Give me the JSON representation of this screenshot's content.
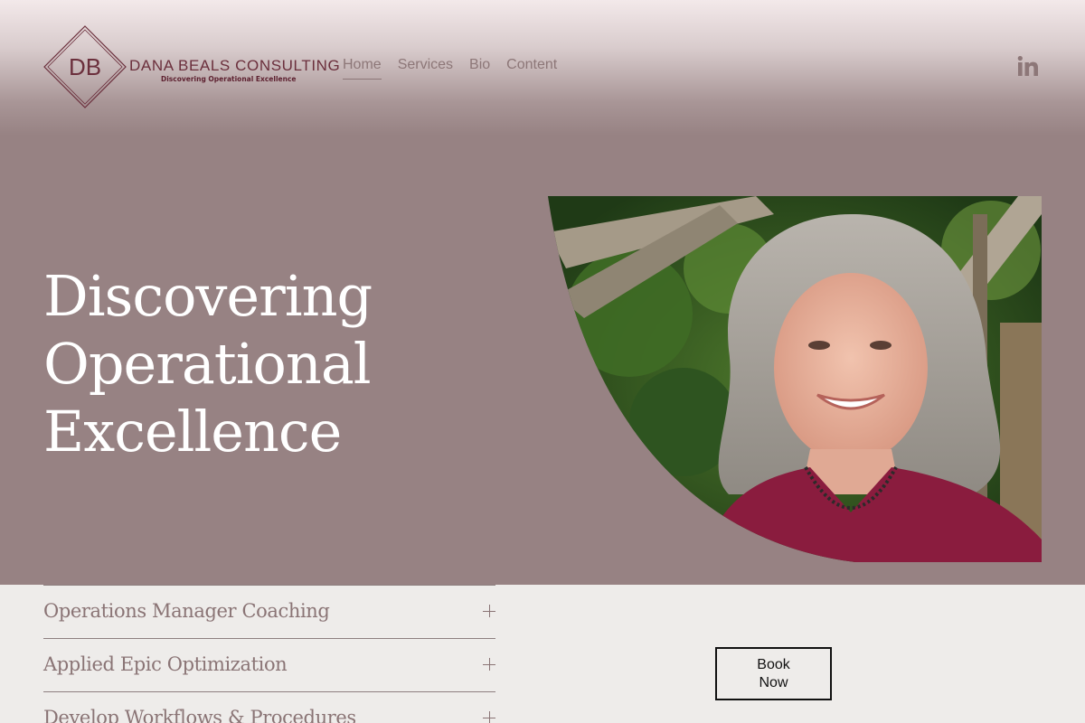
{
  "brand": {
    "monogram": "DB",
    "name": "Dana Beals Consulting",
    "tagline": "Discovering Operational Excellence",
    "accent_color": "#6b2f3c"
  },
  "nav": {
    "items": [
      {
        "label": "Home",
        "active": true
      },
      {
        "label": "Services",
        "active": false
      },
      {
        "label": "Bio",
        "active": false
      },
      {
        "label": "Content",
        "active": false
      }
    ],
    "social_icon": "linkedin-icon"
  },
  "hero": {
    "title": "Discovering Operational Excellence",
    "background_color": "#978283"
  },
  "accordion": {
    "items": [
      {
        "label": "Operations Manager Coaching",
        "icon": "plus-icon"
      },
      {
        "label": "Applied Epic Optimization",
        "icon": "plus-icon"
      },
      {
        "label": "Develop Workflows & Procedures",
        "icon": "plus-icon"
      }
    ]
  },
  "cta": {
    "label": "Book Now"
  }
}
